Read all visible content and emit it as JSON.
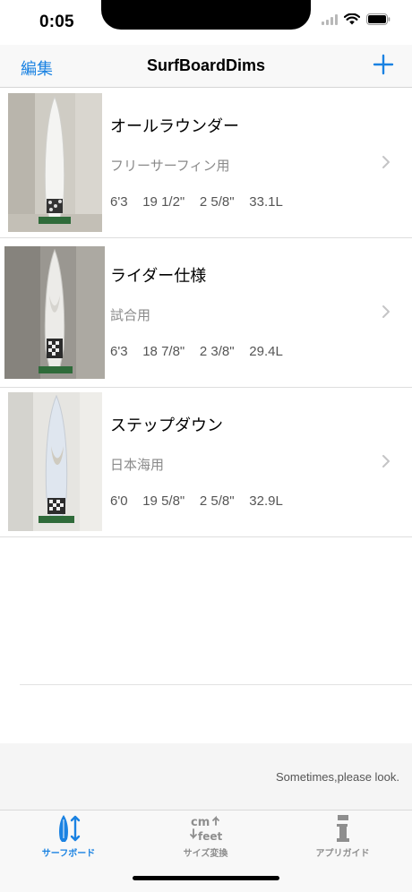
{
  "status_bar": {
    "time": "0:05"
  },
  "nav": {
    "edit_label": "編集",
    "title": "SurfBoardDims"
  },
  "boards": [
    {
      "name": "オールラウンダー",
      "use": "フリーサーフィン用",
      "dims": "6'3    19 1/2\"    2 5/8\"    33.1L"
    },
    {
      "name": "ライダー仕様",
      "use": "試合用",
      "dims": "6'3    18 7/8\"    2 3/8\"    29.4L"
    },
    {
      "name": "ステップダウン",
      "use": "日本海用",
      "dims": "6'0    19 5/8\"    2 5/8\"    32.9L"
    }
  ],
  "footer": {
    "message": "Sometimes,please look."
  },
  "tabs": [
    {
      "label": "サーフボード",
      "icon": "surfboard-icon",
      "active": true
    },
    {
      "label": "サイズ変換",
      "icon": "cm-feet-icon",
      "active": false
    },
    {
      "label": "アプリガイド",
      "icon": "info-icon",
      "active": false
    }
  ],
  "colors": {
    "accent": "#1a82e2",
    "secondary_text": "#8a8a8a",
    "inactive_tab": "#8e8e8e"
  }
}
